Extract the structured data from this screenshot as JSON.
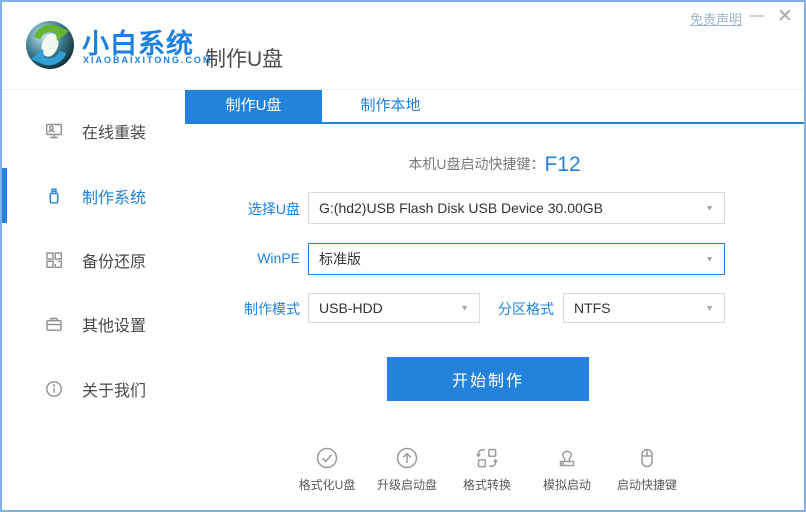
{
  "window": {
    "disclaimer": "免责声明",
    "minimize_icon": "—",
    "close_icon": "✕"
  },
  "header": {
    "brand_name": "小白系统",
    "brand_domain": "XIAOBAIXITONG.COM",
    "page_title": "制作U盘"
  },
  "sidebar": {
    "items": [
      {
        "label": "在线重装",
        "icon": "online-reinstall-icon",
        "active": false
      },
      {
        "label": "制作系统",
        "icon": "usb-drive-icon",
        "active": true
      },
      {
        "label": "备份还原",
        "icon": "backup-restore-icon",
        "active": false
      },
      {
        "label": "其他设置",
        "icon": "other-settings-icon",
        "active": false
      },
      {
        "label": "关于我们",
        "icon": "about-us-icon",
        "active": false
      }
    ]
  },
  "tabs": [
    {
      "label": "制作U盘",
      "active": true
    },
    {
      "label": "制作本地",
      "active": false
    }
  ],
  "main": {
    "hotkey_label": "本机U盘启动快捷键：",
    "hotkey_value": "F12",
    "usb_select": {
      "label": "选择U盘",
      "value": "G:(hd2)USB Flash Disk USB Device 30.00GB"
    },
    "winpe_select": {
      "label": "WinPE",
      "value": "标准版"
    },
    "mode_select": {
      "label": "制作模式",
      "value": "USB-HDD"
    },
    "partition_select": {
      "label": "分区格式",
      "value": "NTFS"
    },
    "start_button": "开始制作"
  },
  "footer_tools": [
    {
      "label": "格式化U盘",
      "icon": "format-usb-icon"
    },
    {
      "label": "升级启动盘",
      "icon": "upgrade-bootdisk-icon"
    },
    {
      "label": "格式转换",
      "icon": "format-convert-icon"
    },
    {
      "label": "模拟启动",
      "icon": "simulate-boot-icon"
    },
    {
      "label": "启动快捷键",
      "icon": "boot-hotkey-icon"
    }
  ],
  "colors": {
    "primary_blue": "#2383dc",
    "accent_text_blue": "#1f82dd",
    "window_border": "#7fb2e0",
    "muted_link": "#9db4c9"
  }
}
